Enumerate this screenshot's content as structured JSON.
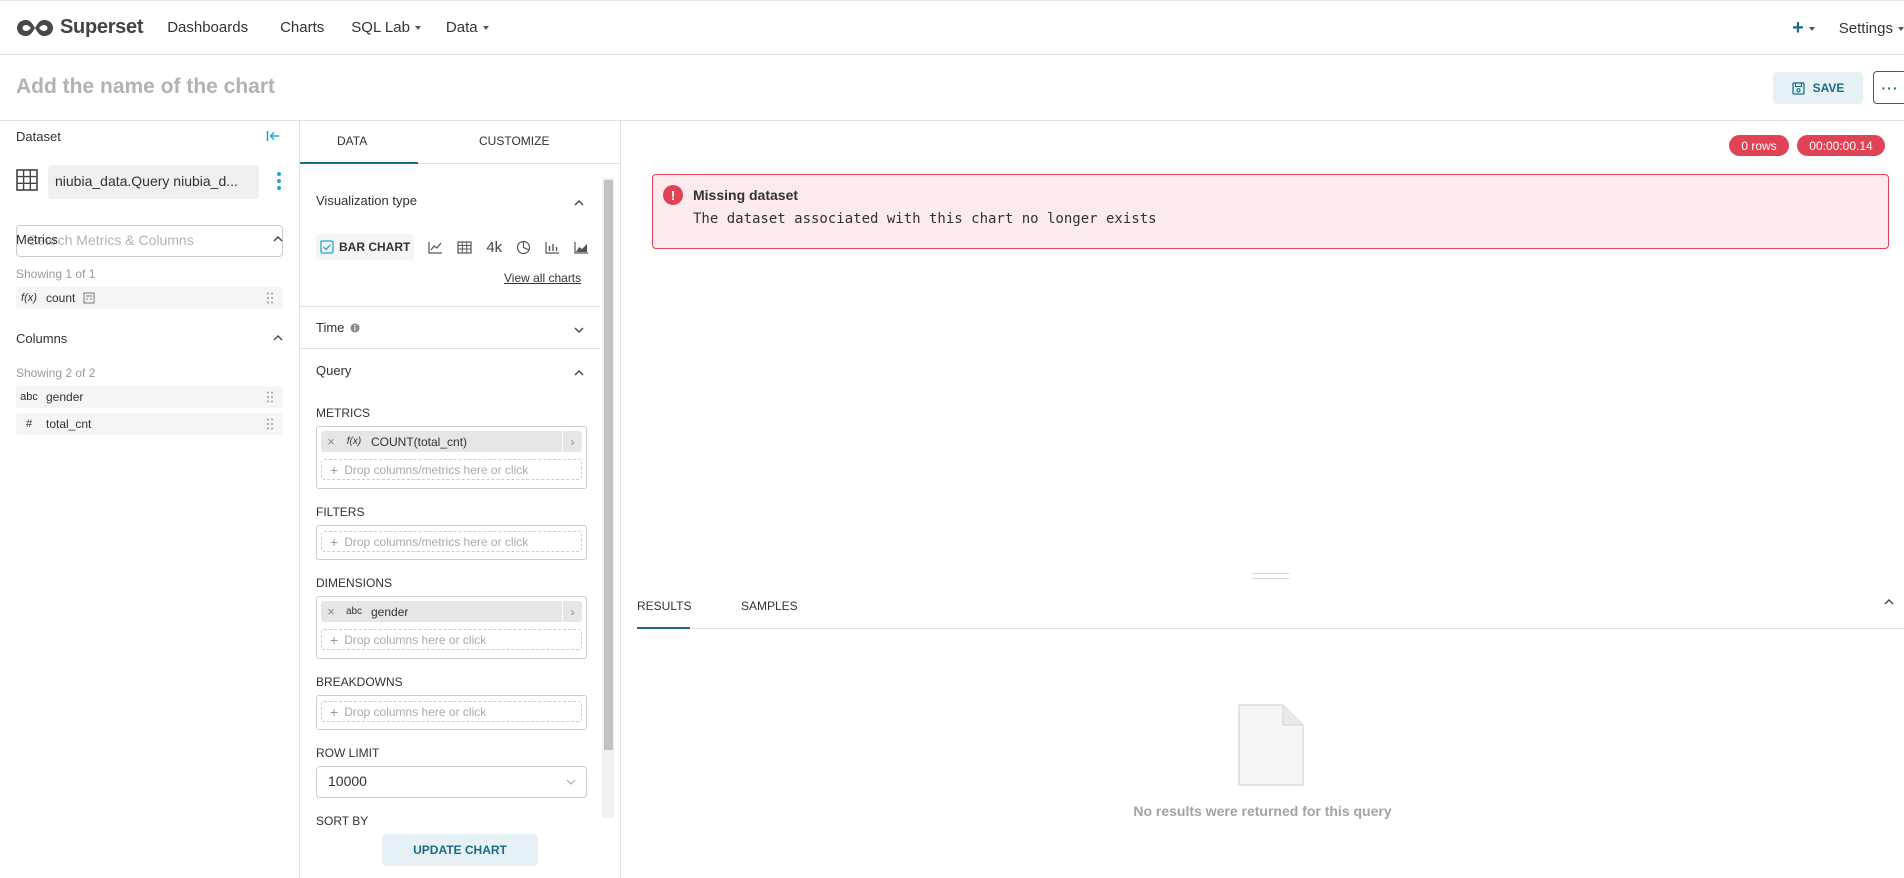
{
  "nav": {
    "brand": "Superset",
    "items": [
      {
        "label": "Dashboards",
        "dropdown": false
      },
      {
        "label": "Charts",
        "dropdown": false
      },
      {
        "label": "SQL Lab",
        "dropdown": true
      },
      {
        "label": "Data",
        "dropdown": true
      }
    ],
    "plus_label": "+",
    "settings_label": "Settings"
  },
  "header": {
    "chart_name_placeholder": "Add the name of the chart",
    "save_label": "SAVE",
    "more_label": "···"
  },
  "dataset_panel": {
    "title": "Dataset",
    "dataset_name": "niubia_data.Query niubia_d...",
    "search_placeholder": "Search Metrics & Columns",
    "metrics": {
      "title": "Metrics",
      "showing": "Showing 1 of 1",
      "items": [
        {
          "type": "f(x)",
          "name": "count"
        }
      ]
    },
    "columns": {
      "title": "Columns",
      "showing": "Showing 2 of 2",
      "items": [
        {
          "type": "abc",
          "name": "gender"
        },
        {
          "type": "#",
          "name": "total_cnt"
        }
      ]
    }
  },
  "control_panel": {
    "tabs": [
      "DATA",
      "CUSTOMIZE"
    ],
    "active_tab": "DATA",
    "visualization": {
      "title": "Visualization type",
      "selected": "BAR CHART",
      "other_icons": [
        "line-chart-icon",
        "table-icon",
        "big-number-icon",
        "pie-chart-icon",
        "bar-chart-icon",
        "area-chart-icon"
      ],
      "big_number_label": "4k",
      "view_all": "View all charts"
    },
    "time": {
      "title": "Time"
    },
    "query": {
      "title": "Query",
      "metrics_label": "METRICS",
      "metric_chip": {
        "type": "f(x)",
        "label": "COUNT(total_cnt)"
      },
      "metrics_drop": "Drop columns/metrics here or click",
      "filters_label": "FILTERS",
      "filters_drop": "Drop columns/metrics here or click",
      "dimensions_label": "DIMENSIONS",
      "dimension_chip": {
        "type": "abc",
        "label": "gender"
      },
      "dimensions_drop": "Drop columns here or click",
      "breakdowns_label": "BREAKDOWNS",
      "breakdowns_drop": "Drop columns here or click",
      "row_limit_label": "ROW LIMIT",
      "row_limit_value": "10000",
      "sort_by_label": "SORT BY"
    },
    "update_label": "UPDATE CHART"
  },
  "chart_area": {
    "rows_badge": "0 rows",
    "time_badge": "00:00:00.14",
    "alert_title": "Missing dataset",
    "alert_message": "The dataset associated with this chart no longer exists",
    "results_tabs": [
      "RESULTS",
      "SAMPLES"
    ],
    "empty_message": "No results were returned for this query"
  },
  "colors": {
    "primary": "#1b6b87",
    "accent": "#20a7c9",
    "error": "#e04355",
    "error_bg": "#fcebed"
  }
}
